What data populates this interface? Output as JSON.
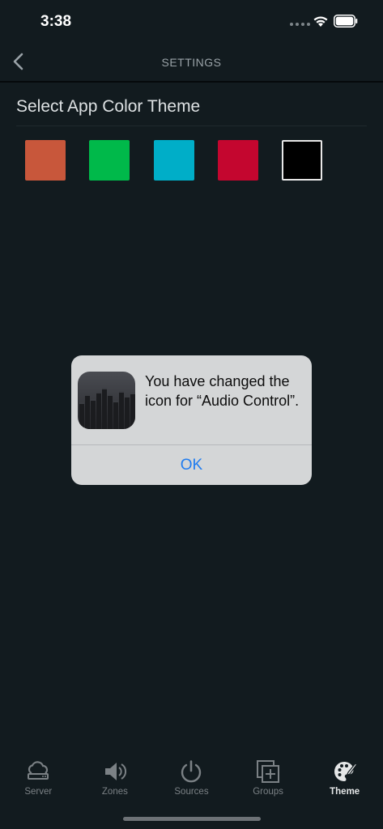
{
  "status_bar": {
    "time": "3:38"
  },
  "nav": {
    "title": "SETTINGS",
    "back_icon": "chevron-left-icon"
  },
  "theme_section": {
    "title": "Select App Color Theme",
    "swatches": [
      {
        "name": "orange",
        "color": "#c8573b"
      },
      {
        "name": "green",
        "color": "#00b94a"
      },
      {
        "name": "cyan",
        "color": "#00aec8"
      },
      {
        "name": "red",
        "color": "#c4062f"
      },
      {
        "name": "black",
        "color": "#000000",
        "selected": true
      }
    ]
  },
  "alert": {
    "message": "You have changed the icon for “Audio Control”.",
    "ok_label": "OK",
    "icon": "audio-control-app-icon"
  },
  "tab_bar": {
    "items": [
      {
        "label": "Server",
        "icon": "cloud-server-icon",
        "active": false
      },
      {
        "label": "Zones",
        "icon": "speaker-icon",
        "active": false
      },
      {
        "label": "Sources",
        "icon": "power-icon",
        "active": false
      },
      {
        "label": "Groups",
        "icon": "layers-plus-icon",
        "active": false
      },
      {
        "label": "Theme",
        "icon": "palette-icon",
        "active": true
      }
    ]
  },
  "colors": {
    "background": "#121b1f",
    "alert_background": "#d4d6d7",
    "accent_blue": "#1f7cf0"
  }
}
